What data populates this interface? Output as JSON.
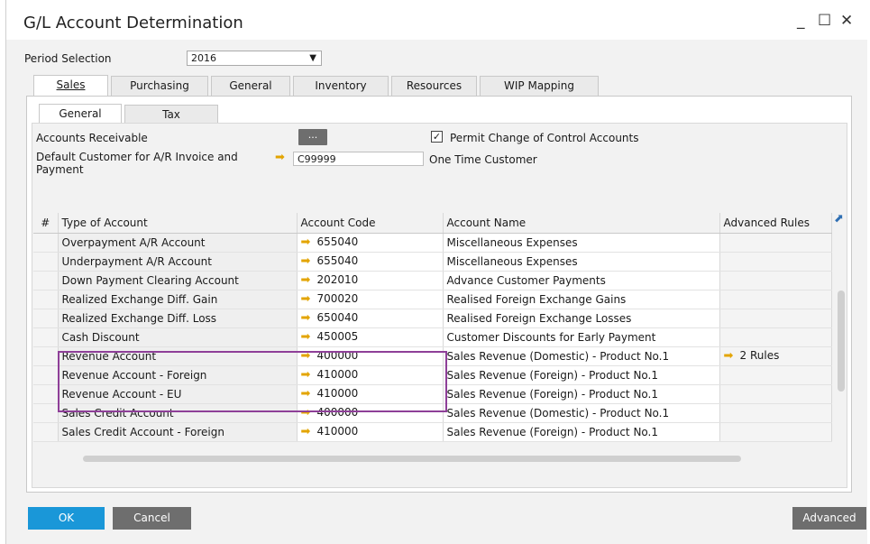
{
  "window": {
    "title": "G/L Account Determination",
    "minimize": "_",
    "maximize": "☐",
    "close": "✕"
  },
  "period": {
    "label": "Period Selection",
    "value": "2016"
  },
  "tabs": [
    {
      "label": "Sales"
    },
    {
      "label": "Purchasing"
    },
    {
      "label": "General"
    },
    {
      "label": "Inventory"
    },
    {
      "label": "Resources"
    },
    {
      "label": "WIP Mapping"
    }
  ],
  "subtabs": [
    {
      "label": "General"
    },
    {
      "label": "Tax"
    }
  ],
  "form": {
    "accounts_receivable_label": "Accounts Receivable",
    "ellipsis": "...",
    "permit_change_label": "Permit Change of Control Accounts",
    "permit_change_checked": "✓",
    "default_customer_label": "Default Customer for A/R Invoice and Payment",
    "default_customer_code": "C99999",
    "default_customer_name": "One Time Customer"
  },
  "grid": {
    "headers": {
      "num": "#",
      "type": "Type of Account",
      "code": "Account Code",
      "name": "Account Name",
      "adv": "Advanced Rules"
    },
    "rows": [
      {
        "type": "Overpayment A/R Account",
        "code": "655040",
        "name": "Miscellaneous Expenses",
        "adv": ""
      },
      {
        "type": "Underpayment A/R Account",
        "code": "655040",
        "name": "Miscellaneous Expenses",
        "adv": ""
      },
      {
        "type": "Down Payment Clearing Account",
        "code": "202010",
        "name": "Advance Customer Payments",
        "adv": ""
      },
      {
        "type": "Realized Exchange Diff. Gain",
        "code": "700020",
        "name": "Realised Foreign Exchange Gains",
        "adv": ""
      },
      {
        "type": "Realized Exchange Diff. Loss",
        "code": "650040",
        "name": "Realised Foreign Exchange Losses",
        "adv": ""
      },
      {
        "type": "Cash Discount",
        "code": "450005",
        "name": "Customer Discounts for Early Payment",
        "adv": ""
      },
      {
        "type": "Revenue Account",
        "code": "400000",
        "name": "Sales Revenue (Domestic) - Product No.1",
        "adv": "2 Rules"
      },
      {
        "type": "Revenue Account - Foreign",
        "code": "410000",
        "name": "Sales Revenue (Foreign) - Product No.1",
        "adv": ""
      },
      {
        "type": "Revenue Account - EU",
        "code": "410000",
        "name": "Sales Revenue (Foreign) - Product No.1",
        "adv": ""
      },
      {
        "type": "Sales Credit Account",
        "code": "400000",
        "name": "Sales Revenue (Domestic) - Product No.1",
        "adv": ""
      },
      {
        "type": "Sales Credit Account - Foreign",
        "code": "410000",
        "name": "Sales Revenue (Foreign) - Product No.1",
        "adv": ""
      }
    ]
  },
  "buttons": {
    "ok": "OK",
    "cancel": "Cancel",
    "advanced": "Advanced"
  },
  "colors": {
    "accent": "#1a97d8",
    "highlight": "#8e3f98",
    "arrow": "#e3a400"
  }
}
